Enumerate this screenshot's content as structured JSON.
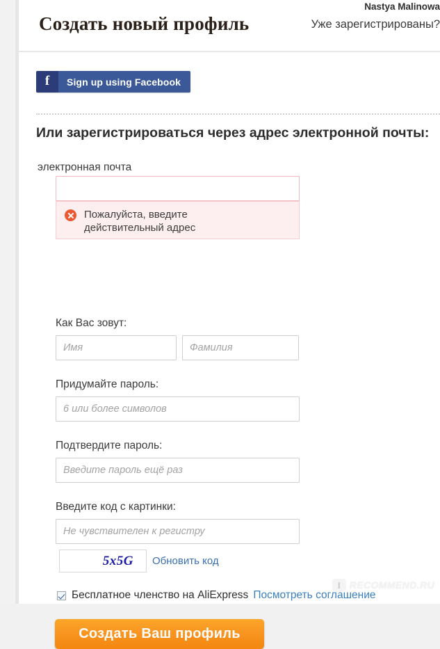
{
  "header": {
    "title": "Создать новый профиль",
    "account_name": "Nastya Malinowa",
    "already_registered": "Уже зарегистрированы?"
  },
  "social": {
    "facebook_icon": "facebook-f-icon",
    "facebook_label": "Sign up using Facebook",
    "facebook_bg": "#3b5998",
    "facebook_icon_bg": "#2b3c78"
  },
  "form": {
    "email_section_heading": "Или зарегистрироваться через адрес электронной почты:",
    "email": {
      "label": "электронная почта",
      "value": "",
      "placeholder": "",
      "error_text": "Пожалуйста, введите действительный адрес",
      "error_icon": "error-circle-x-icon",
      "error_color": "#ea5932",
      "error_bg": "#fdeef0"
    },
    "names": {
      "label": "Как Вас зовут:",
      "first_name_placeholder": "Имя",
      "first_name_value": "",
      "last_name_placeholder": "Фамилия",
      "last_name_value": ""
    },
    "password": {
      "label": "Придумайте пароль:",
      "placeholder": "6 или более символов",
      "value": ""
    },
    "password_confirm": {
      "label": "Подтвердите пароль:",
      "placeholder": "Введите пароль ещё раз",
      "value": ""
    },
    "captcha": {
      "label": "Введите код с картинки:",
      "placeholder": "Не чувствителен к регистру",
      "value": "",
      "image_code": "5x5G",
      "image_code_color": "#1a1aa6",
      "refresh_label": "Обновить код"
    },
    "agreement": {
      "checked": true,
      "text": "Бесплатное членство на AliExpress",
      "link_text": "Посмотреть соглашение",
      "link_color": "#3a7fc1"
    },
    "submit_label": "Создать Ваш профиль",
    "submit_color": "#f89420"
  },
  "watermark": {
    "icon": "speech-bubble-i-icon",
    "icon_letter": "I",
    "text": "RECOMMEND.RU"
  }
}
